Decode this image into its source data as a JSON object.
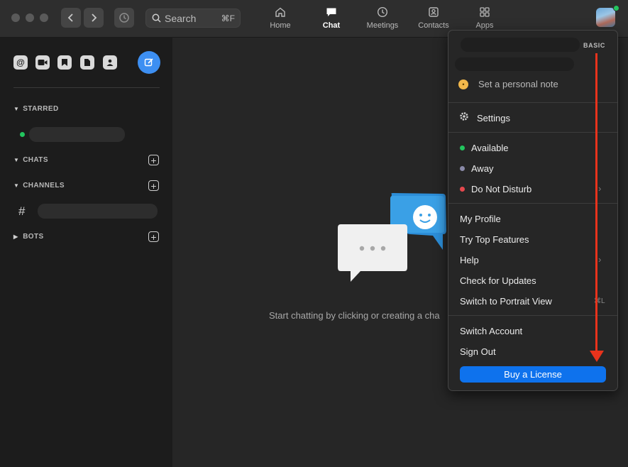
{
  "search": {
    "placeholder": "Search",
    "shortcut": "⌘F"
  },
  "tabs": [
    {
      "label": "Home",
      "icon": "home-icon"
    },
    {
      "label": "Chat",
      "icon": "chat-icon",
      "active": true
    },
    {
      "label": "Meetings",
      "icon": "clock-icon"
    },
    {
      "label": "Contacts",
      "icon": "contact-icon"
    },
    {
      "label": "Apps",
      "icon": "apps-icon"
    }
  ],
  "sidebar": {
    "quick_icons": [
      "at-icon",
      "video-icon",
      "bookmark-icon",
      "file-icon",
      "contact-card-icon"
    ],
    "sections": {
      "starred": "STARRED",
      "chats": "CHATS",
      "channels": "CHANNELS",
      "bots": "BOTS"
    },
    "channel_glyph": "#"
  },
  "main": {
    "empty_message": "Start chatting by clicking or creating a cha"
  },
  "menu": {
    "plan_badge": "BASIC",
    "personal_note": "Set a personal note",
    "settings": "Settings",
    "status": [
      {
        "label": "Available",
        "color": "#22c55e"
      },
      {
        "label": "Away",
        "color": "#8a8aa8"
      },
      {
        "label": "Do Not Disturb",
        "color": "#e5484d"
      }
    ],
    "items": [
      "My Profile",
      "Try Top Features",
      "Help",
      "Check for Updates",
      "Switch to Portrait View"
    ],
    "portrait_shortcut": "⌘L",
    "account": [
      "Switch Account",
      "Sign Out"
    ],
    "buy_label": "Buy a License"
  },
  "colors": {
    "accent": "#0e72ed",
    "annotation": "#e8331c",
    "compose": "#3d8ff2"
  }
}
